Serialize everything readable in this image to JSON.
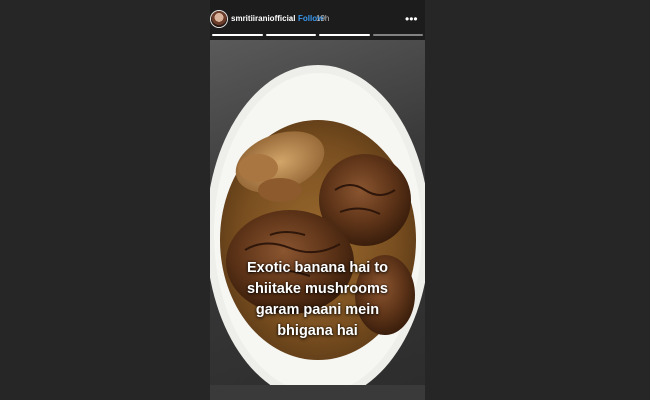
{
  "story": {
    "username": "smritiiraniofficial",
    "separator": "•",
    "follow_label": "Follow",
    "timestamp": "19h",
    "more_icon": "more-horizontal-icon",
    "progress": {
      "segments": 4,
      "completed": 3
    },
    "caption_lines": [
      "Exotic banana hai to",
      "shiitake mushrooms",
      "garam paani mein",
      "bhigana hai"
    ]
  },
  "colors": {
    "page_background": "#262626",
    "follow_link": "#3897f0",
    "caption_text": "#ffffff"
  }
}
